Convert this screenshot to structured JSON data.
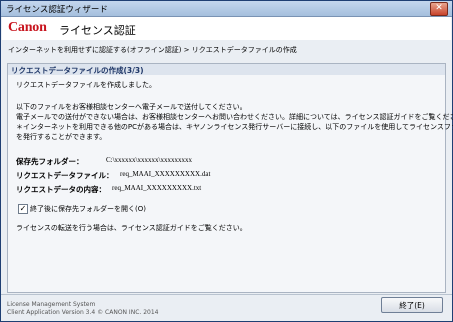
{
  "window": {
    "title": "ライセンス認証ウィザード"
  },
  "header": {
    "logo": "Canon",
    "title": "ライセンス認証"
  },
  "breadcrumb": "インターネットを利用せずに認証する(オフライン認証) > リクエストデータファイルの作成",
  "section": {
    "title": "リクエストデータファイルの作成(3/3)",
    "created_msg": "リクエストデータファイルを作成しました。",
    "instructions": [
      "以下のファイルをお客様相談センターへ電子メールで送付してください。",
      "電子メールでの送付ができない場合は、お客様相談センターへお問い合わせください。詳細については、ライセンス認証ガイドをご覧ください。",
      "＊インターネットを利用できる他のPCがある場合は、キヤノンライセンス発行サーバーに接続し、以下のファイルを使用してライセンスファイル",
      "を発行することができます。"
    ],
    "fields": [
      {
        "label": "保存先フォルダー：",
        "value": "C:\\xxxxxx\\xxxxxx\\xxxxxxxxx"
      },
      {
        "label": "リクエストデータファイル：",
        "value": "req_MAAI_XXXXXXXXX.dat"
      },
      {
        "label": "リクエストデータの内容：",
        "value": "req_MAAI_XXXXXXXXX.txt"
      }
    ],
    "checkbox_label": "終了後に保存先フォルダーを開く(O)",
    "checkbox_checked": true,
    "transfer_note": "ライセンスの転送を行う場合は、ライセンス認証ガイドをご覧ください。"
  },
  "footer": {
    "line1": "License Management System",
    "line2": "Client Application Version 3.4   © CANON INC. 2014",
    "finish_label": "終了(E)"
  }
}
